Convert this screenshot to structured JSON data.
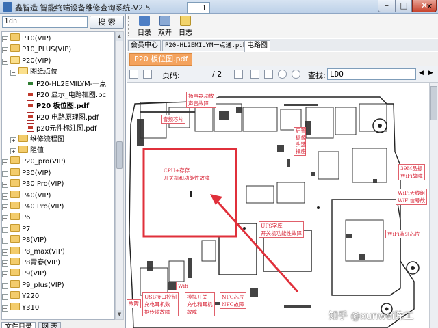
{
  "window": {
    "title": "鑫智造 智能终端设备维修查询系统-V2.5",
    "buttons": {
      "minimize": "–",
      "maximize": "□",
      "close": "✕"
    }
  },
  "sidebar": {
    "search_value": "ldn",
    "search_button": "搜 索",
    "tree": [
      {
        "label": "P10(VIP)",
        "kind": "folder",
        "expander": "+"
      },
      {
        "label": "P10_PLUS(VIP)",
        "kind": "folder",
        "expander": "+"
      },
      {
        "label": "P20(VIP)",
        "kind": "folder-open",
        "expander": "−"
      },
      {
        "label": "图纸点位",
        "kind": "folder-open",
        "expander": "−"
      },
      {
        "label": "P20-HL2EMILYM-一点",
        "kind": "file-green",
        "expander": ""
      },
      {
        "label": "P20 显示_电路框图.pc",
        "kind": "pdf",
        "expander": ""
      },
      {
        "label": "P20 板位图.pdf",
        "kind": "pdf",
        "expander": "",
        "bold": true
      },
      {
        "label": "P20 电路原理图.pdf",
        "kind": "pdf",
        "expander": ""
      },
      {
        "label": "p20元件标注图.pdf",
        "kind": "pdf",
        "expander": ""
      },
      {
        "label": "维修流程图",
        "kind": "folder",
        "expander": "+"
      },
      {
        "label": "阻值",
        "kind": "folder",
        "expander": "+"
      },
      {
        "label": "P20_pro(VIP)",
        "kind": "folder",
        "expander": "+"
      },
      {
        "label": "P30(VIP)",
        "kind": "folder",
        "expander": "+"
      },
      {
        "label": "P30 Pro(VIP)",
        "kind": "folder",
        "expander": "+"
      },
      {
        "label": "P40(VIP)",
        "kind": "folder",
        "expander": "+"
      },
      {
        "label": "P40 Pro(VIP)",
        "kind": "folder",
        "expander": "+"
      },
      {
        "label": "P6",
        "kind": "folder",
        "expander": "+"
      },
      {
        "label": "P7",
        "kind": "folder",
        "expander": "+"
      },
      {
        "label": "P8(VIP)",
        "kind": "folder",
        "expander": "+"
      },
      {
        "label": "P8_max(VIP)",
        "kind": "folder",
        "expander": "+"
      },
      {
        "label": "P8青春(VIP)",
        "kind": "folder",
        "expander": "+"
      },
      {
        "label": "P9(VIP)",
        "kind": "folder",
        "expander": "+"
      },
      {
        "label": "P9_plus(VIP)",
        "kind": "folder",
        "expander": "+"
      },
      {
        "label": "Y220",
        "kind": "folder",
        "expander": "+"
      },
      {
        "label": "Y310",
        "kind": "folder",
        "expander": "+"
      }
    ],
    "bottom_tabs": [
      "文件目录",
      "网 表"
    ]
  },
  "toolbar": {
    "items": [
      {
        "label": "目录",
        "icon": "catalog-icon"
      },
      {
        "label": "双开",
        "icon": "dual-open-icon"
      },
      {
        "label": "日志",
        "icon": "log-icon"
      }
    ]
  },
  "doc_tabs": [
    "会员中心",
    "P20-HL2EMILYM一点通.pcb",
    "电路图"
  ],
  "sub_tab": "P20 板位图.pdf",
  "pdf_toolbar": {
    "page_label": "页码:",
    "page_value": "1",
    "page_total": "/ 2",
    "find_label": "查找:",
    "find_value": "LDO"
  },
  "annotations": [
    "扬声器功放\n声音故障",
    "音频芯片",
    "后置\n摄像\n头选\n择座",
    "CPU+存存\n开关机和功能性故障",
    "39M晶振\nWiFi故障",
    "WiFi天线组\nWiFi信号故",
    "WiFi蓝牙芯片",
    "UFS字库\n开关机功能性故障",
    "USB接口控制\n充电耳机数\n据传输故障",
    "模拟开关\n充电和耳机\n故障",
    "NFC芯片\nNFC故障",
    "故障",
    "Wifi"
  ],
  "watermark": "知乎 @xunwei陈工",
  "colors": {
    "accent_tab": "#f4a35e",
    "annotation": "#d8283a",
    "board_highlight": "#e0303b"
  }
}
